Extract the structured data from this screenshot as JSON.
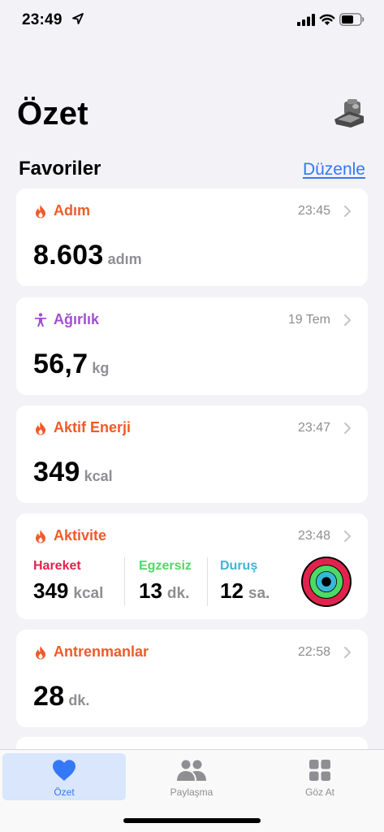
{
  "status": {
    "time": "23:49"
  },
  "header": {
    "title": "Özet"
  },
  "favorites": {
    "title": "Favoriler",
    "edit_label": "Düzenle"
  },
  "cards": [
    {
      "label": "Adım",
      "time": "23:45",
      "value": "8.603",
      "unit": "adım",
      "icon": "flame-icon",
      "color": "#f05a28"
    },
    {
      "label": "Ağırlık",
      "time": "19 Tem",
      "value": "56,7",
      "unit": "kg",
      "icon": "figure-icon",
      "color": "#a14fd0"
    },
    {
      "label": "Aktif Enerji",
      "time": "23:47",
      "value": "349",
      "unit": "kcal",
      "icon": "flame-icon",
      "color": "#f05a28"
    },
    {
      "label": "Antrenmanlar",
      "time": "22:58",
      "value": "28",
      "unit": "dk.",
      "icon": "flame-icon",
      "color": "#f05a28"
    }
  ],
  "activity": {
    "label": "Aktivite",
    "time": "23:48",
    "move": {
      "label": "Hareket",
      "value": "349",
      "unit": "kcal",
      "color": "#e0234d"
    },
    "exercise": {
      "label": "Egzersiz",
      "value": "13",
      "unit": "dk.",
      "color": "#4cd964"
    },
    "stand": {
      "label": "Duruş",
      "value": "12",
      "unit": "sa.",
      "color": "#3ab6d6"
    }
  },
  "tabs": [
    {
      "label": "Özet",
      "icon": "heart-icon",
      "active": true
    },
    {
      "label": "Paylaşma",
      "icon": "people-icon",
      "active": false
    },
    {
      "label": "Göz At",
      "icon": "grid-icon",
      "active": false
    }
  ],
  "colors": {
    "accent": "#3478f6",
    "background": "#f2f2f7"
  }
}
